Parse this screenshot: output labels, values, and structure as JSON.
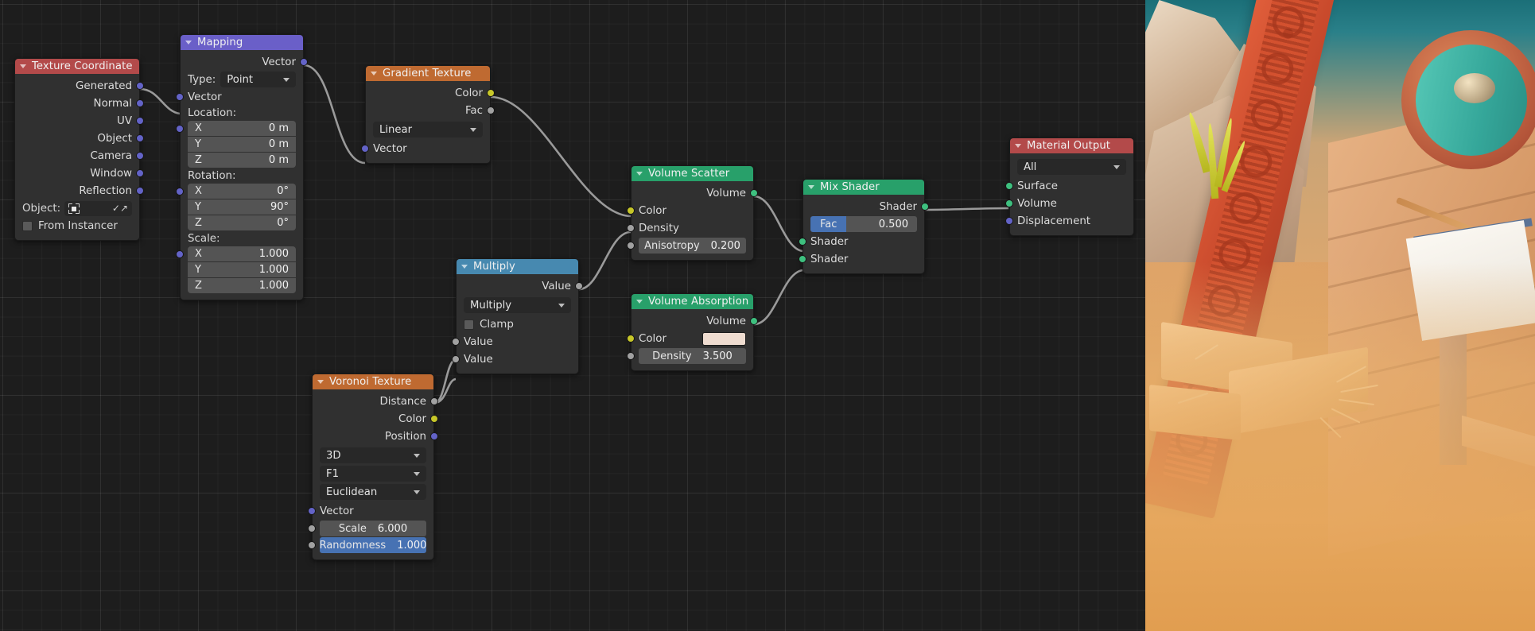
{
  "editor": {
    "name": "Blender Shader Node Editor",
    "background_color": "#1d1d1d"
  },
  "nodes": [
    {
      "id": "texture-coordinate",
      "title": "Texture Coordinate",
      "header_color": "#b34a4a",
      "outputs": [
        "Generated",
        "Normal",
        "UV",
        "Object",
        "Camera",
        "Window",
        "Reflection"
      ],
      "object_label": "Object:",
      "object_value": "",
      "from_instancer_label": "From Instancer"
    },
    {
      "id": "mapping",
      "title": "Mapping",
      "header_color": "#6a5fc8",
      "output_label": "Vector",
      "type_label": "Type:",
      "type_value": "Point",
      "input_label": "Vector",
      "location_label": "Location:",
      "location": [
        {
          "axis": "X",
          "value": "0 m"
        },
        {
          "axis": "Y",
          "value": "0 m"
        },
        {
          "axis": "Z",
          "value": "0 m"
        }
      ],
      "rotation_label": "Rotation:",
      "rotation": [
        {
          "axis": "X",
          "value": "0°"
        },
        {
          "axis": "Y",
          "value": "90°"
        },
        {
          "axis": "Z",
          "value": "0°"
        }
      ],
      "scale_label": "Scale:",
      "scale": [
        {
          "axis": "X",
          "value": "1.000"
        },
        {
          "axis": "Y",
          "value": "1.000"
        },
        {
          "axis": "Z",
          "value": "1.000"
        }
      ]
    },
    {
      "id": "gradient-texture",
      "title": "Gradient Texture",
      "header_color": "#bf6a31",
      "outputs": [
        "Color",
        "Fac"
      ],
      "mode": "Linear",
      "input_label": "Vector"
    },
    {
      "id": "volume-scatter",
      "title": "Volume Scatter",
      "header_color": "#28a06a",
      "output_label": "Volume",
      "color_label": "Color",
      "density_label": "Density",
      "anisotropy_label": "Anisotropy",
      "anisotropy_value": "0.200"
    },
    {
      "id": "volume-absorption",
      "title": "Volume Absorption",
      "header_color": "#28a06a",
      "output_label": "Volume",
      "color_label": "Color",
      "color_value": "#efdcd0",
      "density_label": "Density",
      "density_value": "3.500"
    },
    {
      "id": "mix-shader",
      "title": "Mix Shader",
      "header_color": "#28a06a",
      "output_label": "Shader",
      "fac_label": "Fac",
      "fac_value": "0.500",
      "fac_slider_color": "#4772b3",
      "shader_inputs": [
        "Shader",
        "Shader"
      ]
    },
    {
      "id": "material-output",
      "title": "Material Output",
      "header_color": "#b34a4a",
      "target": "All",
      "inputs": [
        "Surface",
        "Volume",
        "Displacement"
      ]
    },
    {
      "id": "multiply",
      "title": "Multiply",
      "header_color": "#4789b0",
      "output_label": "Value",
      "operation": "Multiply",
      "clamp_label": "Clamp",
      "inputs": [
        "Value",
        "Value"
      ]
    },
    {
      "id": "voronoi-texture",
      "title": "Voronoi Texture",
      "header_color": "#bf6a31",
      "outputs": [
        "Distance",
        "Color",
        "Position"
      ],
      "dimensions": "3D",
      "feature": "F1",
      "metric": "Euclidean",
      "vector_label": "Vector",
      "scale_label": "Scale",
      "scale_value": "6.000",
      "randomness_label": "Randomness",
      "randomness_value": "1.000",
      "randomness_slider_color": "#4772b3"
    }
  ],
  "socket_colors": {
    "vector": "#6363c7",
    "color": "#c7c729",
    "shader": "#3ec07f",
    "value": "#a1a1a1"
  },
  "viewport": {
    "name": "3d-rendered-preview"
  }
}
